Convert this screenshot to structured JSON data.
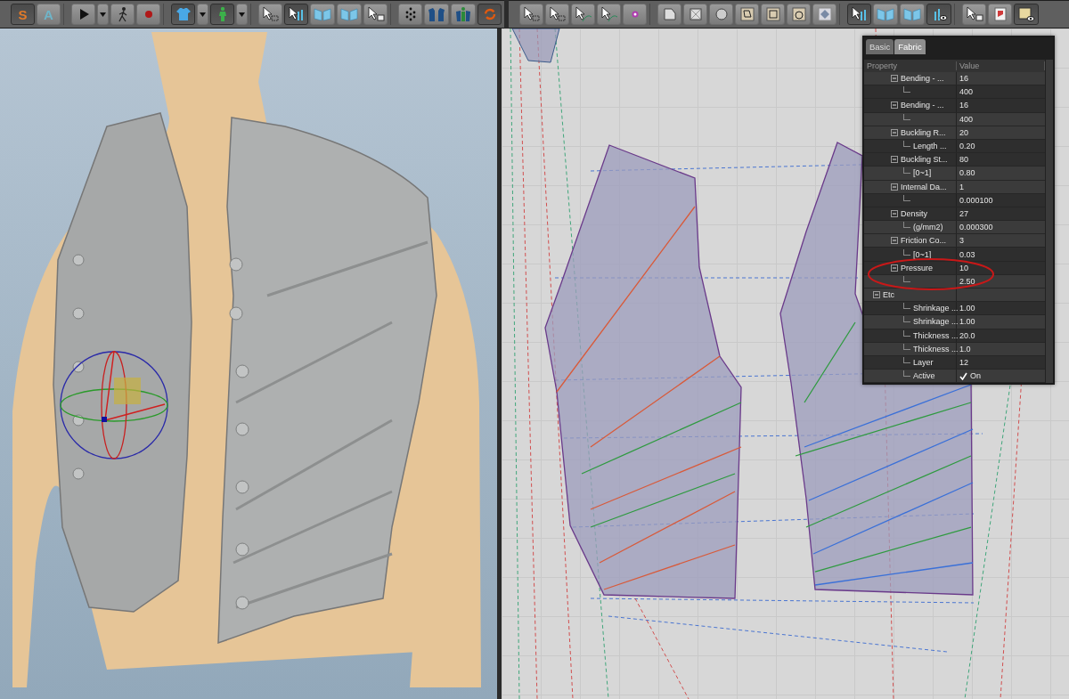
{
  "left_toolbar": {
    "groups": [
      {
        "tools": [
          {
            "label": "S",
            "selected": true
          },
          {
            "label": "A",
            "selected": false
          }
        ]
      },
      {
        "tools": [
          {
            "selected": false
          },
          {
            "selected": false
          },
          {
            "selected": false
          },
          {
            "selected": false
          }
        ]
      },
      {
        "tools": [
          {
            "selected": true
          },
          {
            "selected": false
          },
          {
            "selected": true
          },
          {
            "selected": false
          }
        ]
      },
      {
        "tools": [
          {
            "selected": false
          },
          {
            "selected": true
          },
          {
            "selected": false
          },
          {
            "selected": false
          },
          {
            "selected": false
          }
        ]
      },
      {
        "tools": [
          {
            "selected": false
          },
          {
            "selected": false
          },
          {
            "selected": false
          },
          {
            "selected": true
          }
        ]
      }
    ]
  },
  "right_toolbar": {
    "groups": [
      {
        "tools": [
          {
            "selected": false
          },
          {
            "selected": false
          },
          {
            "selected": false
          },
          {
            "selected": false
          },
          {
            "selected": false
          }
        ]
      },
      {
        "tools": [
          {
            "selected": false
          },
          {
            "selected": false
          },
          {
            "selected": false
          },
          {
            "selected": false
          },
          {
            "selected": false
          },
          {
            "selected": false
          },
          {
            "selected": false
          }
        ]
      },
      {
        "tools": [
          {
            "selected": true
          },
          {
            "selected": false
          },
          {
            "selected": false
          },
          {
            "selected": true
          }
        ]
      },
      {
        "tools": [
          {
            "selected": false
          },
          {
            "selected": false
          },
          {
            "selected": true
          }
        ]
      }
    ]
  },
  "property_panel": {
    "tabs": [
      {
        "label": "Basic",
        "selected": false
      },
      {
        "label": "Fabric",
        "selected": true
      }
    ],
    "columns": [
      "Property",
      "Value"
    ],
    "rows": [
      {
        "kind": "text",
        "label": "Bending - ...",
        "value": "16",
        "expanded": true,
        "children": [
          {
            "kind": "text",
            "value": "400"
          }
        ]
      },
      {
        "kind": "text",
        "label": "Bending - ...",
        "value": "16",
        "expanded": true,
        "children": [
          {
            "kind": "text",
            "value": "400"
          }
        ]
      },
      {
        "kind": "text",
        "label": "Buckling R...",
        "value": "20",
        "expanded": true,
        "children": [
          {
            "kind": "text",
            "label": "Length ...",
            "value": "0.20"
          }
        ]
      },
      {
        "kind": "text",
        "label": "Buckling St...",
        "value": "80",
        "expanded": true,
        "children": [
          {
            "kind": "text",
            "label": "[0~1]",
            "value": "0.80"
          }
        ]
      },
      {
        "kind": "text",
        "label": "Internal Da...",
        "value": "1",
        "expanded": true,
        "children": [
          {
            "kind": "text",
            "value": "0.000100"
          }
        ]
      },
      {
        "kind": "text",
        "label": "Density",
        "value": "27",
        "expanded": true,
        "children": [
          {
            "kind": "text",
            "label": "(g/mm2)",
            "value": "0.000300"
          }
        ]
      },
      {
        "kind": "text",
        "label": "Friction Co...",
        "value": "3",
        "expanded": true,
        "children": [
          {
            "kind": "text",
            "label": "[0~1]",
            "value": "0.03"
          }
        ]
      },
      {
        "kind": "text",
        "label": "Pressure",
        "value": "10",
        "expanded": true,
        "children": [
          {
            "kind": "text",
            "value": "2.50"
          }
        ]
      },
      {
        "kind": "group",
        "label": "Etc",
        "expanded": true,
        "children": [
          {
            "kind": "text",
            "label": "Shrinkage ...",
            "value": "1.00"
          },
          {
            "kind": "text",
            "label": "Shrinkage ...",
            "value": "1.00"
          },
          {
            "kind": "text",
            "label": "Thickness ...",
            "value": "20.0"
          },
          {
            "kind": "text",
            "label": "Thickness ...",
            "value": "1.0"
          },
          {
            "kind": "text",
            "label": "Layer",
            "value": "12"
          },
          {
            "kind": "checkbox",
            "label": "Active",
            "value": "On",
            "checked": true
          }
        ]
      }
    ]
  }
}
